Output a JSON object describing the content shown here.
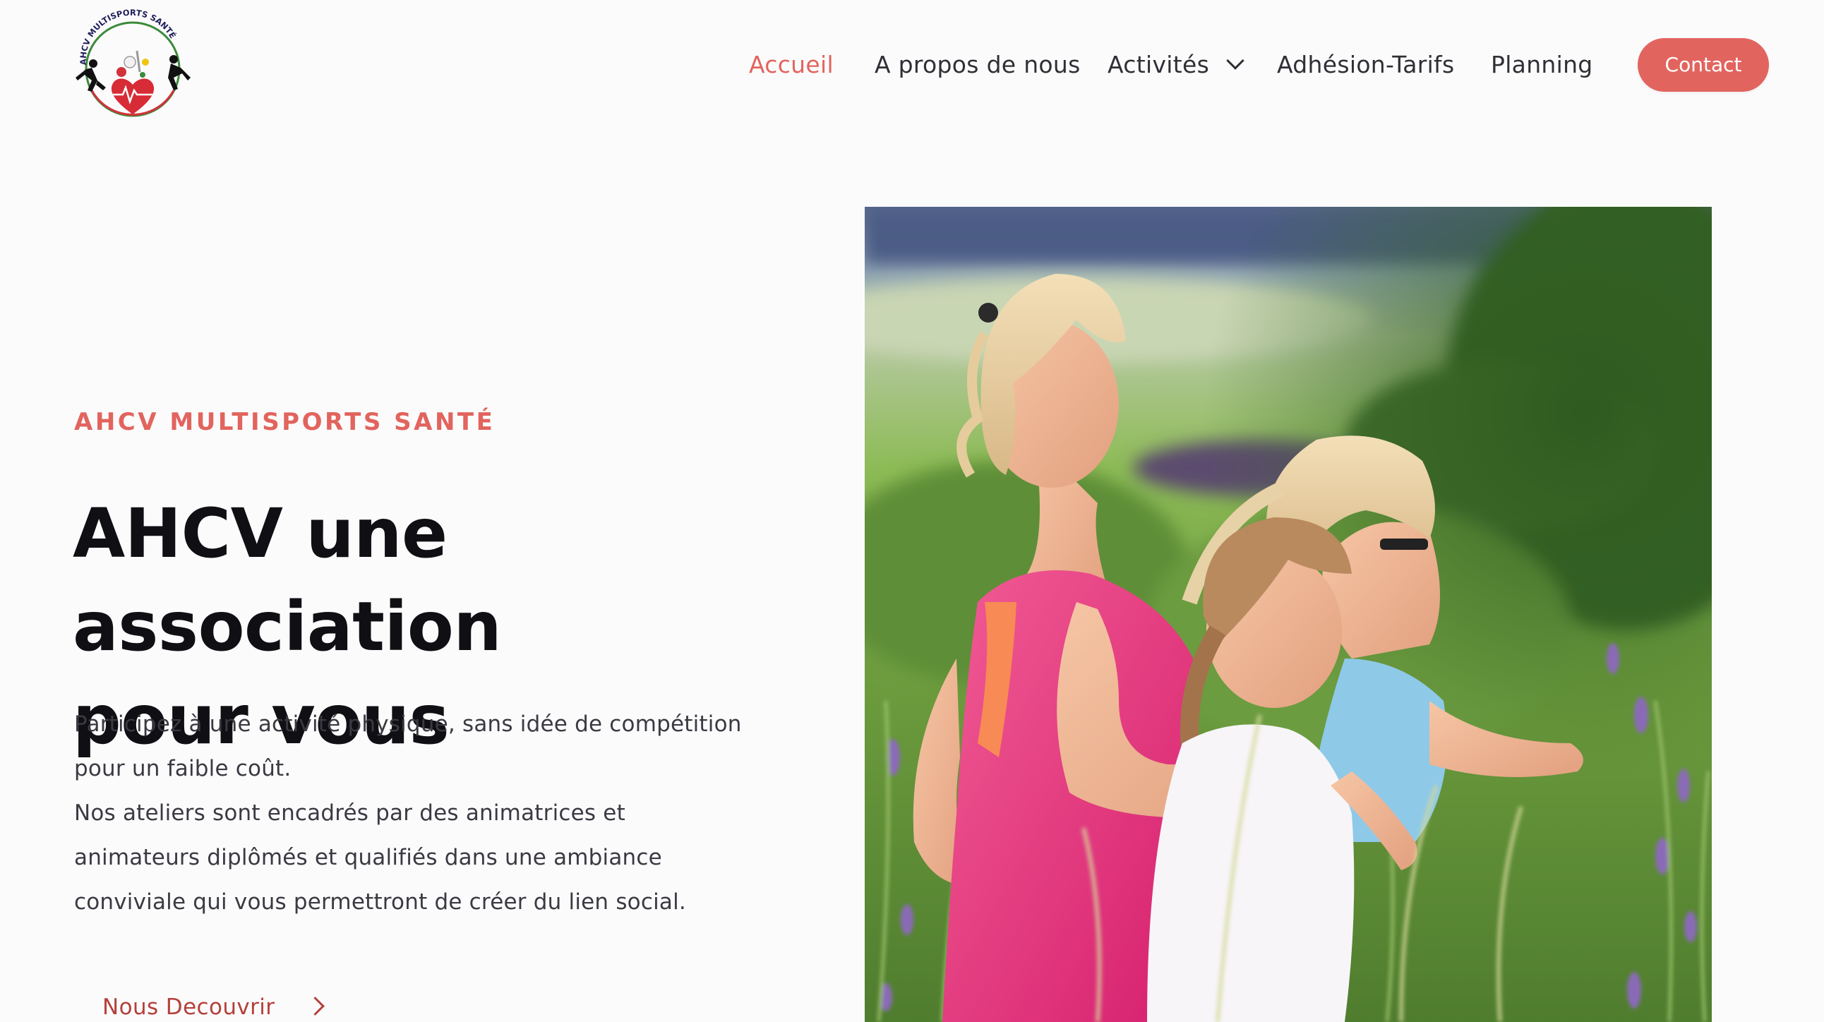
{
  "logo": {
    "alt": "AHCV Multisports Santé logo",
    "arc_text": "AHCV MULTISPORTS SANTÉ",
    "icon": "heart-athletes-logo"
  },
  "nav": {
    "items": [
      {
        "label": "Accueil",
        "active": true
      },
      {
        "label": "A propos de nous",
        "active": false
      },
      {
        "label": "Activités",
        "active": false,
        "has_dropdown": true
      },
      {
        "label": "Adhésion-Tarifs",
        "active": false
      },
      {
        "label": "Planning",
        "active": false
      }
    ],
    "contact_label": "Contact"
  },
  "hero": {
    "eyebrow": "AHCV MULTISPORTS SANTÉ",
    "title_line1": "AHCV une association",
    "title_line2": "pour vous",
    "description_lines": [
      "Participez à une activité physique, sans idée de compétition",
      "pour un faible coût.",
      "Nos ateliers sont encadrés par des animatrices et",
      "animateurs diplômés et qualifiés dans une ambiance",
      "conviviale qui vous permettront de créer du lien social."
    ],
    "cta_label": "Nous Decouvrir",
    "image_alt": "Women and girl running through a field of flowers"
  },
  "colors": {
    "accent": "#e2645e",
    "cta_text": "#b4403b",
    "heading": "#0f0f14",
    "body_text": "#3a3a42",
    "background": "#fcfbfc"
  }
}
